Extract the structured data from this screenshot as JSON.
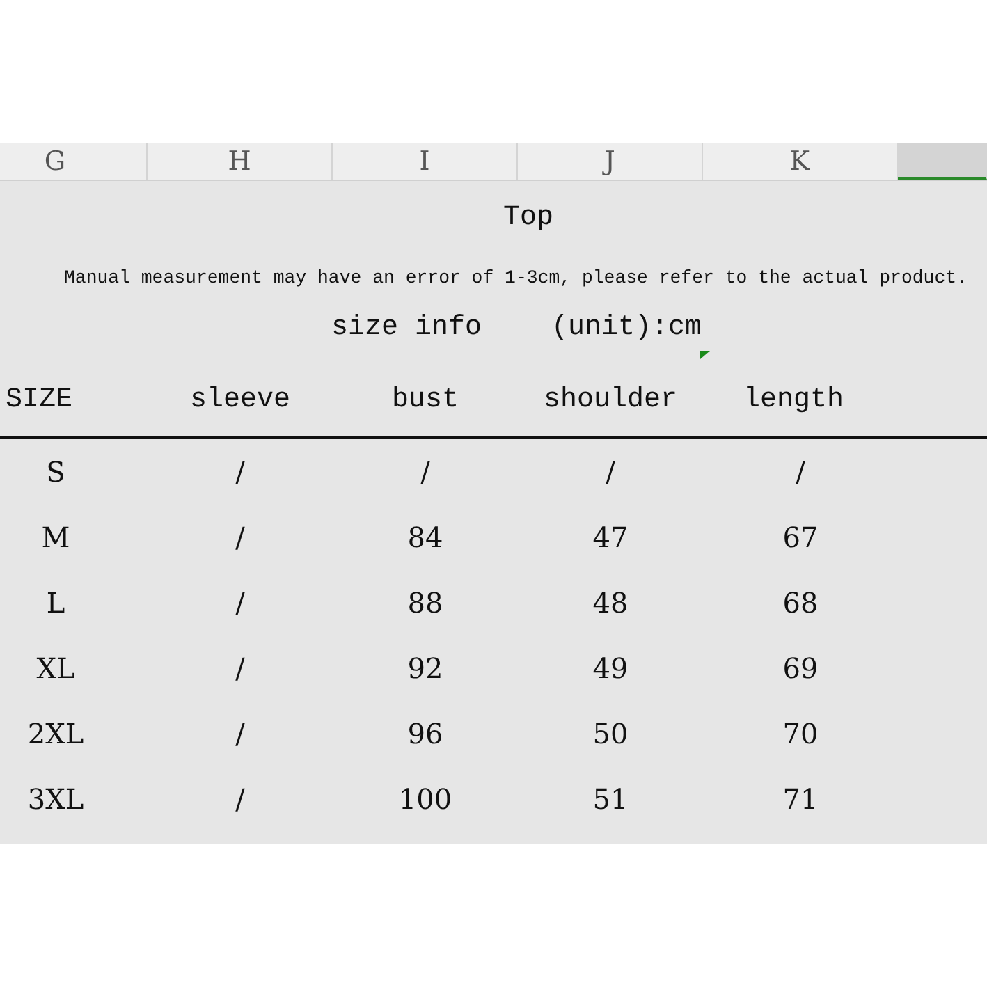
{
  "column_headers": [
    {
      "label": "G",
      "selected": false
    },
    {
      "label": "H",
      "selected": false
    },
    {
      "label": "I",
      "selected": false
    },
    {
      "label": "J",
      "selected": false
    },
    {
      "label": "K",
      "selected": false
    },
    {
      "selected": true
    }
  ],
  "title": "Top",
  "note": "Manual measurement may have an error of 1-3cm, please refer to the actual product.",
  "size_info": {
    "label": "size info",
    "unit": "(unit):cm"
  },
  "table": {
    "columns": [
      "SIZE",
      "sleeve",
      "bust",
      "shoulder",
      "length"
    ],
    "rows": [
      [
        "S",
        "/",
        "/",
        "/",
        "/"
      ],
      [
        "M",
        "/",
        "84",
        "47",
        "67"
      ],
      [
        "L",
        "/",
        "88",
        "48",
        "68"
      ],
      [
        "XL",
        "/",
        "92",
        "49",
        "69"
      ],
      [
        "2XL",
        "/",
        "96",
        "50",
        "70"
      ],
      [
        "3XL",
        "/",
        "100",
        "51",
        "71"
      ]
    ]
  }
}
